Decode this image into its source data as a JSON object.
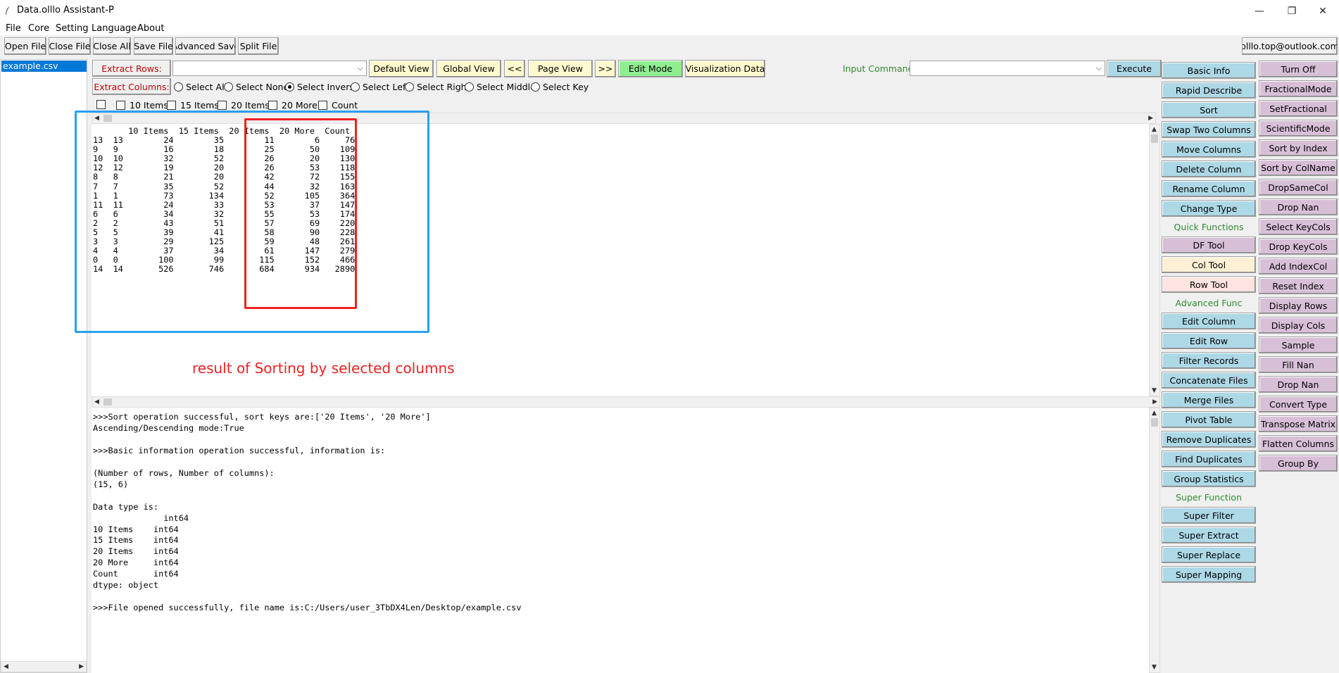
{
  "window": {
    "title": "Data.olllo Assistant-P",
    "controls": {
      "minimize": "—",
      "maximize": "❐",
      "close": "✕"
    }
  },
  "menu": [
    "File",
    "Core",
    "Setting",
    "Language",
    "About"
  ],
  "toolbar": {
    "buttons": [
      "Open File",
      "Close File",
      "Close All",
      "Save File",
      "Advanced Save",
      "Split File"
    ],
    "email": "olllo.top@outlook.com"
  },
  "files": [
    "example.csv"
  ],
  "controls": {
    "extract_rows_label": "Extract Rows:",
    "extract_rows_value": "",
    "default_view": "Default View",
    "global_view": "Global View",
    "prev": "<<",
    "page_view": "Page View",
    "next": ">>",
    "edit_mode": "Edit Mode",
    "visualization": "Visualization Data",
    "input_command_label": "Input Command:",
    "input_command_value": "",
    "execute": "Execute",
    "extract_columns_label": "Extract Columns:",
    "radios": [
      {
        "label": "Select All",
        "checked": false
      },
      {
        "label": "Select None",
        "checked": false
      },
      {
        "label": "Select Inverse",
        "checked": true
      },
      {
        "label": "Select Left",
        "checked": false
      },
      {
        "label": "Select Right",
        "checked": false
      },
      {
        "label": "Select Middle",
        "checked": false
      },
      {
        "label": "Select Key",
        "checked": false
      }
    ],
    "column_checks": [
      "",
      "10 Items",
      "15 Items",
      "20 Items",
      "20 More",
      "Count"
    ]
  },
  "table_text": "       10 Items  15 Items  20 Items  20 More  Count\n13  13        24        35        11        6     76\n9   9         16        18        25       50    109\n10  10        32        52        26       20    130\n12  12        19        20        26       53    118\n8   8         21        20        42       72    155\n7   7         35        52        44       32    163\n1   1         73       134        52      105    364\n11  11        24        33        53       37    147\n6   6         34        32        55       53    174\n2   2         43        51        57       69    220\n5   5         39        41        58       90    228\n3   3         29       125        59       48    261\n4   4         37        34        61      147    279\n0   0        100        99       115      152    466\n14  14       526       746       684      934   2890",
  "annotation": "result of Sorting by selected columns",
  "log_text": ">>>Sort operation successful, sort keys are:['20 Items', '20 More']\nAscending/Descending mode:True\n\n>>>Basic information operation successful, information is:\n\n(Number of rows, Number of columns):\n(15, 6)\n\nData type is:\n              int64\n10 Items    int64\n15 Items    int64\n20 Items    int64\n20 More     int64\nCount       int64\ndtype: object\n\n>>>File opened successfully, file name is:C:/Users/user_3TbDX4Len/Desktop/example.csv",
  "right_col1": [
    {
      "label": "Basic Info",
      "kind": "button",
      "color": "blue"
    },
    {
      "label": "Rapid Describe",
      "kind": "button",
      "color": "blue"
    },
    {
      "label": "Sort",
      "kind": "button",
      "color": "blue"
    },
    {
      "label": "Swap Two Columns",
      "kind": "button",
      "color": "blue"
    },
    {
      "label": "Move Columns",
      "kind": "button",
      "color": "blue"
    },
    {
      "label": "Delete Column",
      "kind": "button",
      "color": "blue"
    },
    {
      "label": "Rename Column",
      "kind": "button",
      "color": "blue"
    },
    {
      "label": "Change Type",
      "kind": "button",
      "color": "blue"
    },
    {
      "label": "Quick Functions",
      "kind": "label"
    },
    {
      "label": "DF Tool",
      "kind": "button",
      "color": "purple"
    },
    {
      "label": "Col Tool",
      "kind": "button",
      "color": "orange"
    },
    {
      "label": "Row Tool",
      "kind": "button",
      "color": "pink"
    },
    {
      "label": "Advanced Func",
      "kind": "label"
    },
    {
      "label": "Edit Column",
      "kind": "button",
      "color": "blue"
    },
    {
      "label": "Edit Row",
      "kind": "button",
      "color": "blue"
    },
    {
      "label": "Filter Records",
      "kind": "button",
      "color": "blue"
    },
    {
      "label": "Concatenate Files",
      "kind": "button",
      "color": "blue"
    },
    {
      "label": "Merge Files",
      "kind": "button",
      "color": "blue"
    },
    {
      "label": "Pivot Table",
      "kind": "button",
      "color": "blue"
    },
    {
      "label": "Remove Duplicates",
      "kind": "button",
      "color": "blue"
    },
    {
      "label": "Find Duplicates",
      "kind": "button",
      "color": "blue"
    },
    {
      "label": "Group Statistics",
      "kind": "button",
      "color": "blue"
    },
    {
      "label": "Super Function",
      "kind": "label"
    },
    {
      "label": "Super Filter",
      "kind": "button",
      "color": "blue"
    },
    {
      "label": "Super Extract",
      "kind": "button",
      "color": "blue"
    },
    {
      "label": "Super Replace",
      "kind": "button",
      "color": "blue"
    },
    {
      "label": "Super Mapping",
      "kind": "button",
      "color": "blue"
    }
  ],
  "right_col2": [
    "Turn Off",
    "FractionalMode",
    "SetFractional",
    "ScientificMode",
    "Sort by Index",
    "Sort by ColName",
    "DropSameCol",
    "Drop Nan",
    "Select KeyCols",
    "Drop KeyCols",
    "Add IndexCol",
    "Reset Index",
    "Display Rows",
    "Display Cols",
    "Sample",
    "Fill Nan",
    "Drop Nan",
    "Convert Type",
    "Transpose Matrix",
    "Flatten Columns",
    "Group By"
  ],
  "colors": {
    "blue": "#add8e6",
    "purple": "#d8bfd8",
    "orange": "#ffefd5",
    "pink": "#ffe4e1",
    "yellow": "#fffacd",
    "green": "#90ee90",
    "highlight_blue": "#2aa0f0",
    "highlight_red": "#ee2222",
    "section_label": "#2e8b2e"
  }
}
